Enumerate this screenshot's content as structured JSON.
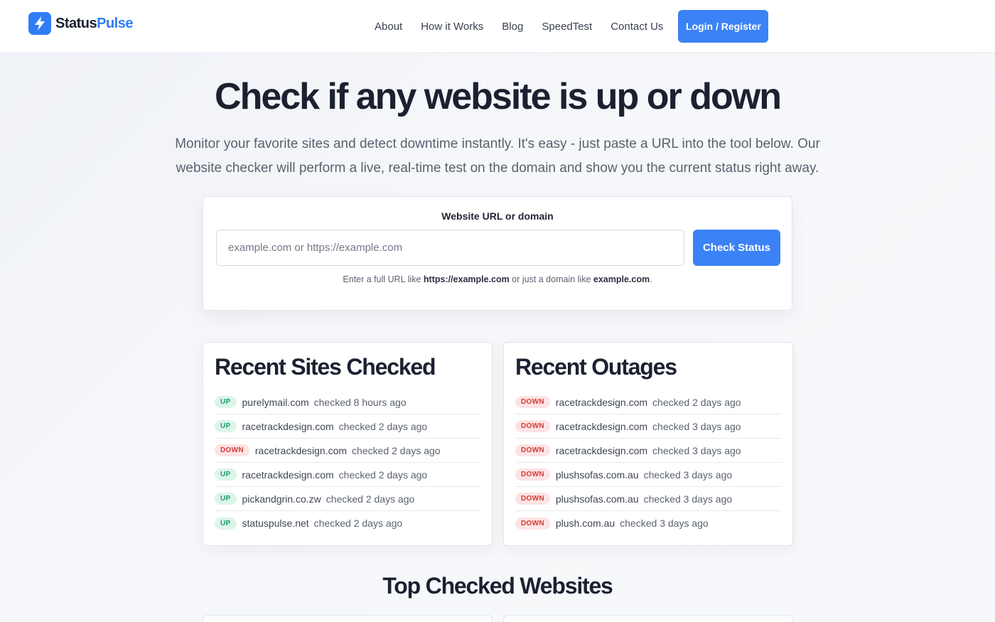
{
  "brand": {
    "name_part1": "Status",
    "name_part2": "Pulse",
    "logo_icon": "lightning-bolt-icon",
    "accent": "#3b82f6"
  },
  "nav": {
    "links": [
      "About",
      "How it Works",
      "Blog",
      "SpeedTest",
      "Contact Us"
    ],
    "login_label": "Login / Register"
  },
  "hero": {
    "title": "Check if any website is up or down",
    "subtitle": "Monitor your favorite sites and detect downtime instantly. It's easy - just paste a URL into the tool below. Our website checker will perform a live, real-time test on the domain and show you the current status right away."
  },
  "checker": {
    "label": "Website URL or domain",
    "placeholder": "example.com or https://example.com",
    "value": "",
    "button_label": "Check Status",
    "help_prefix": "Enter a full URL like ",
    "help_example_url": "https://example.com",
    "help_middle": " or just a domain like ",
    "help_example_domain": "example.com",
    "help_suffix": "."
  },
  "recent_sites": {
    "title": "Recent Sites Checked",
    "rows": [
      {
        "status": "UP",
        "domain": "purelymail.com",
        "when": "checked 8 hours ago"
      },
      {
        "status": "UP",
        "domain": "racetrackdesign.com",
        "when": "checked 2 days ago"
      },
      {
        "status": "DOWN",
        "domain": "racetrackdesign.com",
        "when": "checked 2 days ago"
      },
      {
        "status": "UP",
        "domain": "racetrackdesign.com",
        "when": "checked 2 days ago"
      },
      {
        "status": "UP",
        "domain": "pickandgrin.co.zw",
        "when": "checked 2 days ago"
      },
      {
        "status": "UP",
        "domain": "statuspulse.net",
        "when": "checked 2 days ago"
      }
    ]
  },
  "recent_outages": {
    "title": "Recent Outages",
    "rows": [
      {
        "status": "DOWN",
        "domain": "racetrackdesign.com",
        "when": "checked 2 days ago"
      },
      {
        "status": "DOWN",
        "domain": "racetrackdesign.com",
        "when": "checked 3 days ago"
      },
      {
        "status": "DOWN",
        "domain": "racetrackdesign.com",
        "when": "checked 3 days ago"
      },
      {
        "status": "DOWN",
        "domain": "plushsofas.com.au",
        "when": "checked 3 days ago"
      },
      {
        "status": "DOWN",
        "domain": "plushsofas.com.au",
        "when": "checked 3 days ago"
      },
      {
        "status": "DOWN",
        "domain": "plush.com.au",
        "when": "checked 3 days ago"
      }
    ]
  },
  "top_checked": {
    "title": "Top Checked Websites"
  },
  "colors": {
    "up_bg": "#dcf5ea",
    "up_fg": "#1f9a66",
    "down_bg": "#fde3e3",
    "down_fg": "#d23b3b"
  }
}
